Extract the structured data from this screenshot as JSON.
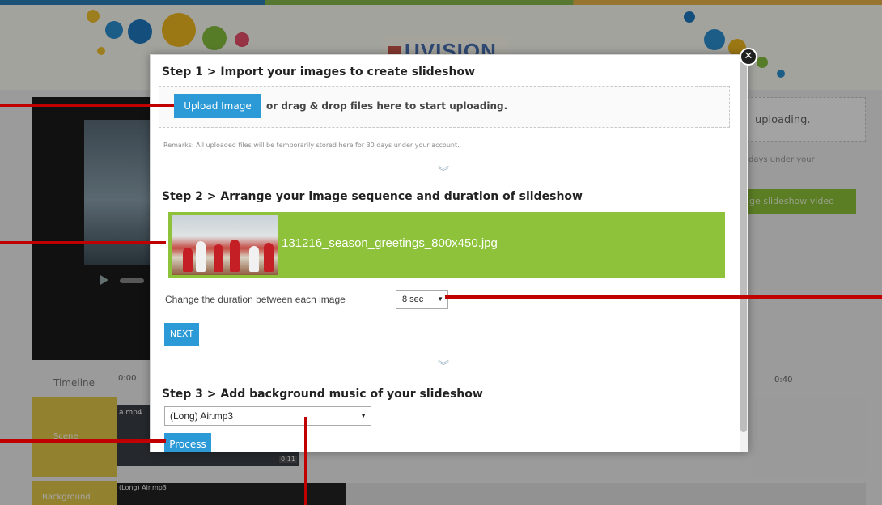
{
  "background": {
    "logo": "UVISION",
    "right_panel_text": "uploading.",
    "right_remark": "days under your",
    "right_button": "ge slideshow video",
    "timeline_label": "Timeline",
    "timeline_start": "0:00",
    "timeline_end": "0:40",
    "scene_label": "Scene",
    "clip_label": "a.mp4",
    "clip_time": "0:11",
    "background_label": "Background",
    "bg_clip_label": "(Long) Air.mp3"
  },
  "modal": {
    "close_symbol": "✕",
    "step1": {
      "title": "Step 1 > Import your images to create slideshow",
      "upload_button": "Upload Image",
      "drop_text": "or drag & drop files here to start uploading.",
      "remark": "Remarks: All uploaded files will be temporarily stored here for 30 days under your account."
    },
    "step2": {
      "title": "Step 2 > Arrange your image sequence and duration of slideshow",
      "image_name": "131216_season_greetings_800x450.jpg",
      "duration_label": "Change the duration between each image",
      "duration_value": "8 sec",
      "next_button": "NEXT"
    },
    "step3": {
      "title": "Step 3 > Add background music of your slideshow",
      "music_value": "(Long) Air.mp3",
      "process_button": "Process"
    },
    "chevron_symbol": "︾"
  },
  "colors": {
    "accent_blue": "#2b9ad6",
    "accent_green": "#8dc23a",
    "callout_red": "#c00000"
  }
}
